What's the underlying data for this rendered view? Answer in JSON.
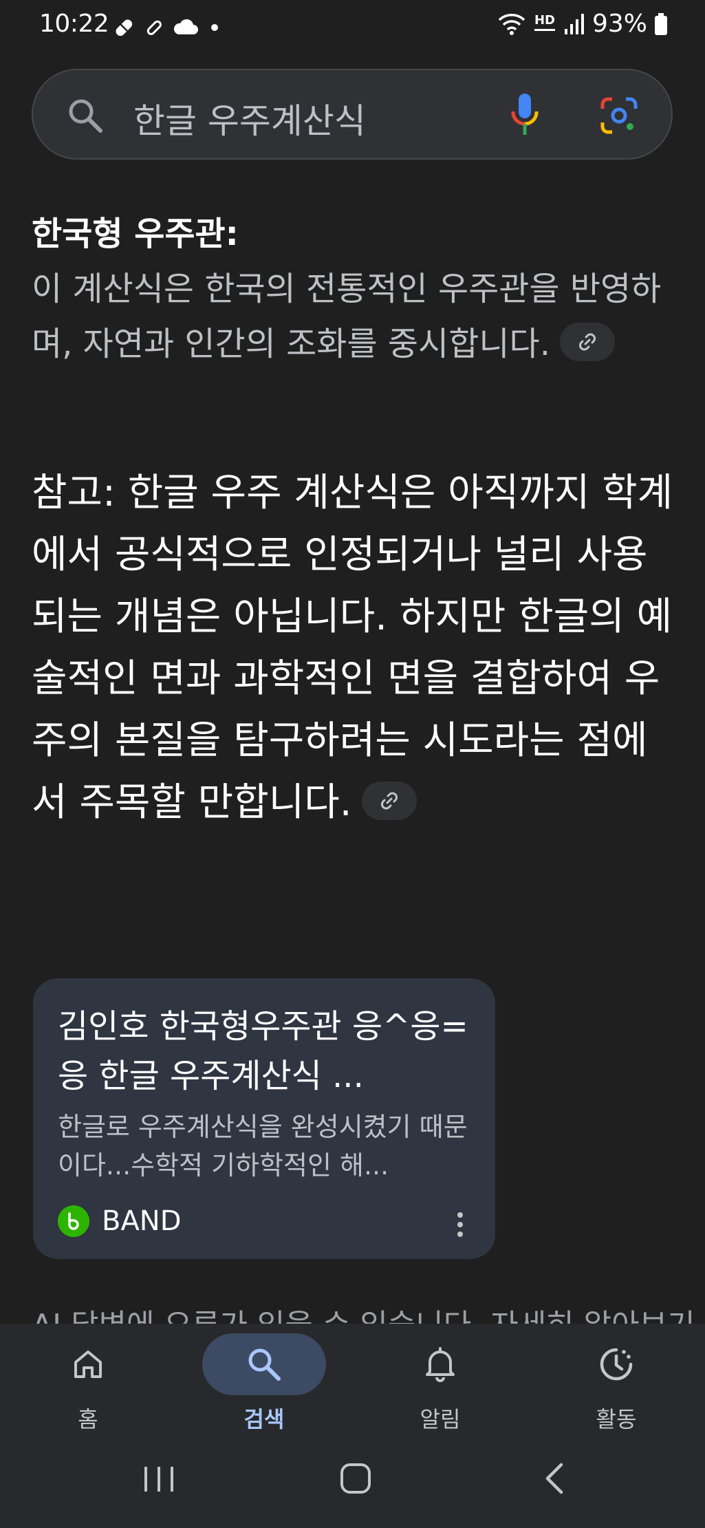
{
  "status_bar": {
    "time": "10:22",
    "battery": "93%",
    "network_label": "HD"
  },
  "search": {
    "query": "한글 우주계산식"
  },
  "content": {
    "heading": "한국형 우주관:",
    "body": "이 계산식은 한국의 전통적인 우주관을 반영하며, 자연과 인간의 조화를 중시합니다.",
    "note": "참고: 한글 우주 계산식은 아직까지 학계에서 공식적으로 인정되거나 널리 사용되는 개념은 아닙니다. 하지만 한글의 예술적인 면과 과학적인 면을 결합하여 우주의 본질을 탐구하려는 시도라는 점에서 주목할 만합니다."
  },
  "card": {
    "title": "김인호 한국형우주관 응^응=응 한글 우주계산식 ...",
    "snippet": "한글로 우주계산식을 완성시켰기 때문이다...수학적 기하학적인 해...",
    "source": "BAND"
  },
  "peek_text": "AI 답변에 오류가 있을 수 있습니다. 자세히 알아보기",
  "bottom_nav": {
    "items": [
      {
        "label": "홈",
        "icon": "home-icon"
      },
      {
        "label": "검색",
        "icon": "search-icon"
      },
      {
        "label": "알림",
        "icon": "bell-icon"
      },
      {
        "label": "활동",
        "icon": "activity-icon"
      }
    ],
    "active_index": 1
  },
  "colors": {
    "background": "#1f1f1f",
    "active_nav": "#a8c7fa",
    "card": "#303542"
  }
}
